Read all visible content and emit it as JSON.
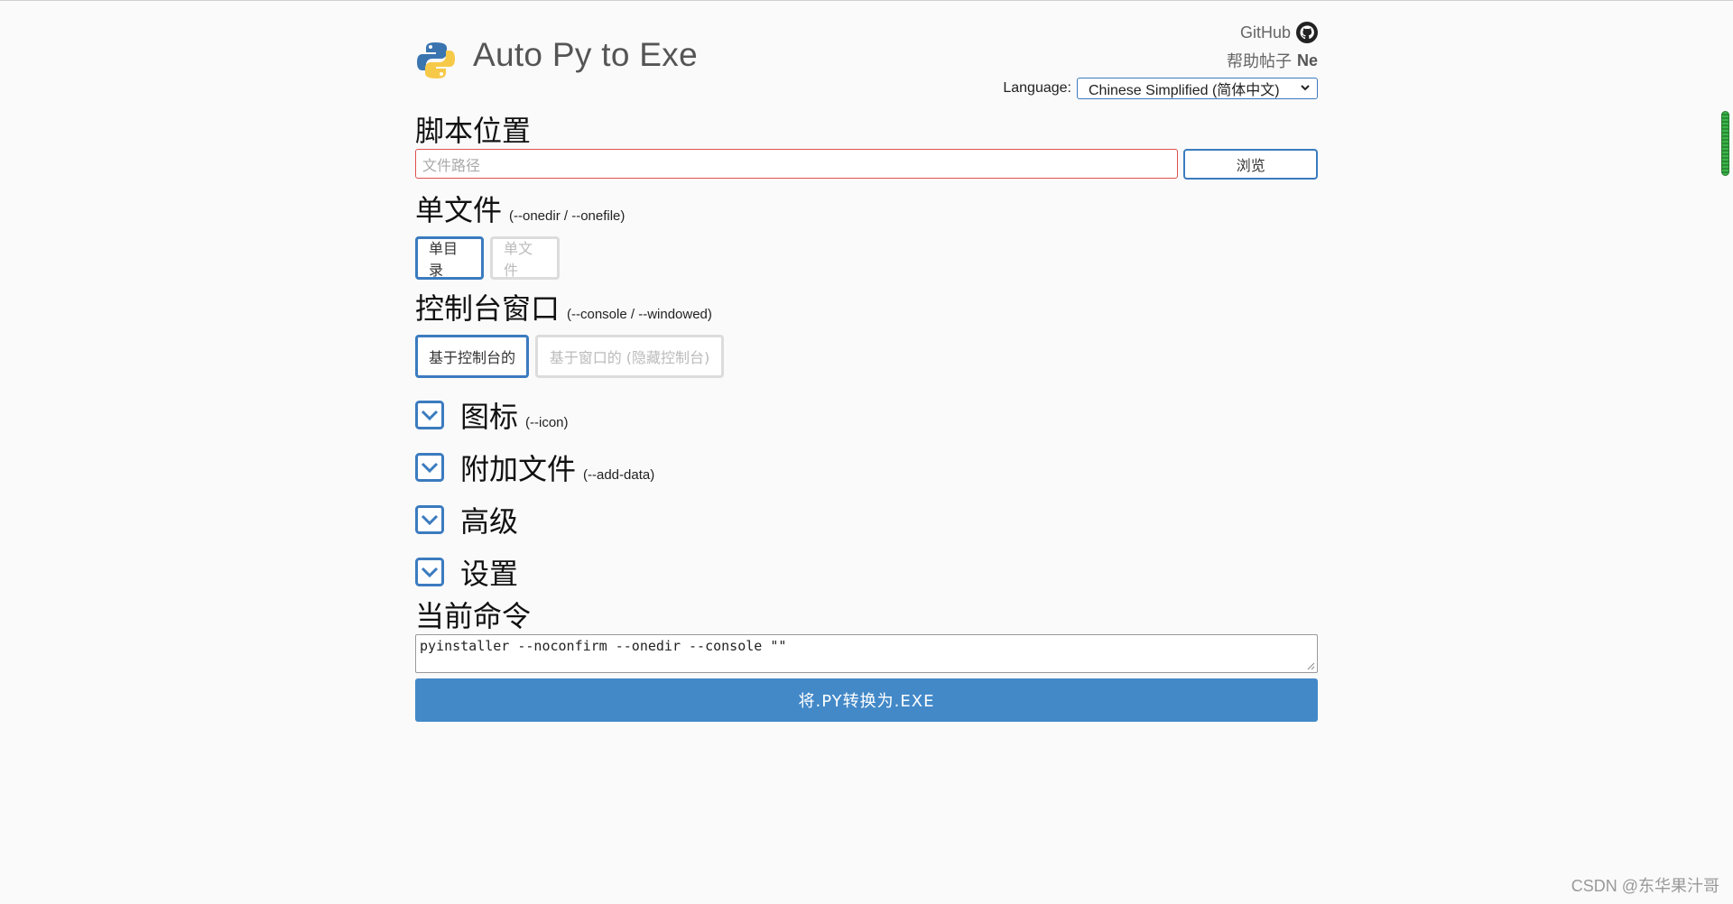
{
  "app": {
    "title": "Auto Py to Exe"
  },
  "header": {
    "github_label": "GitHub",
    "help_label": "帮助帖子",
    "help_extra": "Ne",
    "language_label": "Language:",
    "language_value": "Chinese Simplified (简体中文)"
  },
  "script": {
    "title": "脚本位置",
    "placeholder": "文件路径",
    "browse_label": "浏览"
  },
  "onefile": {
    "title": "单文件",
    "hint": "(--onedir / --onefile)",
    "options": [
      "单目录",
      "单文件"
    ],
    "selected": "单目录"
  },
  "console": {
    "title": "控制台窗口",
    "hint": "(--console / --windowed)",
    "options": [
      "基于控制台的",
      "基于窗口的 (隐藏控制台)"
    ],
    "selected": "基于控制台的"
  },
  "sections": [
    {
      "title": "图标",
      "hint": "(--icon)"
    },
    {
      "title": "附加文件",
      "hint": "(--add-data)"
    },
    {
      "title": "高级",
      "hint": ""
    },
    {
      "title": "设置",
      "hint": ""
    }
  ],
  "command": {
    "title": "当前命令",
    "value": "pyinstaller --noconfirm --onedir --console  \"\""
  },
  "convert": {
    "label": "将.PY转换为.EXE"
  },
  "watermark": "CSDN @东华果汁哥",
  "colors": {
    "accent": "#3b7bbf",
    "convert_bg": "#4389c8",
    "error_border": "#e05050"
  },
  "icons": {
    "logo": "python-logo-icon",
    "github": "github-icon",
    "collapse": "chevron-down-icon"
  }
}
